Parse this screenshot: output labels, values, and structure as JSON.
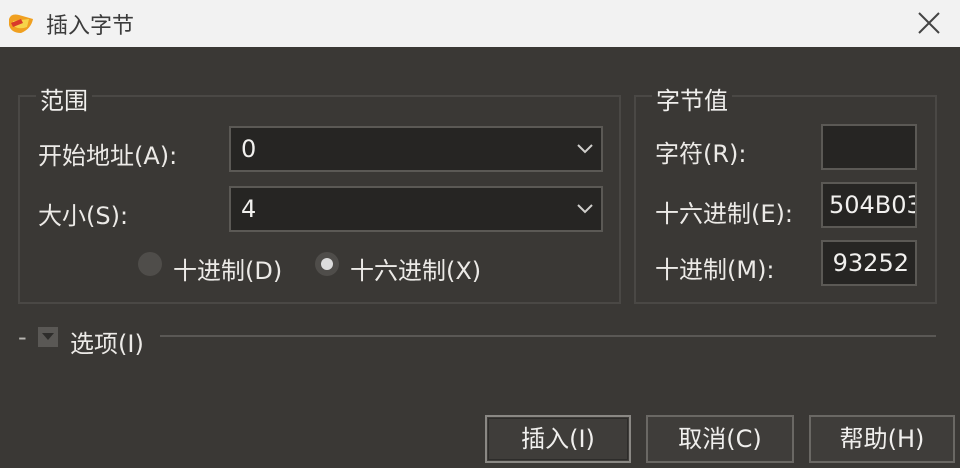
{
  "window": {
    "title": "插入字节",
    "icon": "pencil-app-icon"
  },
  "range_group": {
    "legend": "范围",
    "start_address_label": "开始地址(A):",
    "start_address_value": "0",
    "size_label": "大小(S):",
    "size_value": "4",
    "radio_decimal": "十进制(D)",
    "radio_hex": "十六进制(X)",
    "selected_radix": "hex"
  },
  "byte_value_group": {
    "legend": "字节值",
    "char_label": "字符(R):",
    "char_value": "",
    "hex_label": "十六进制(E):",
    "hex_value": "504B03",
    "decimal_label": "十进制(M):",
    "decimal_value": "93252"
  },
  "options": {
    "dash": "-",
    "label": "选项(I)"
  },
  "buttons": {
    "insert": "插入(I)",
    "cancel": "取消(C)",
    "help": "帮助(H)"
  },
  "colors": {
    "background": "#3a3835",
    "titlebar": "#f2f2f2",
    "input_bg": "#262523"
  }
}
